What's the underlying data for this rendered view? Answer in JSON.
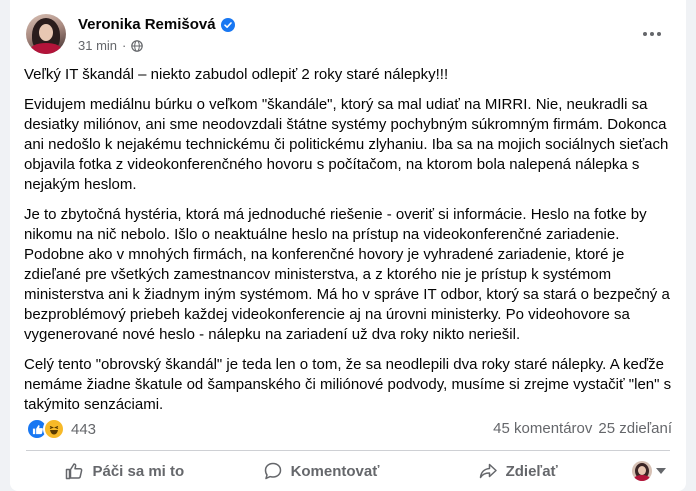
{
  "post": {
    "author": "Veronika Remišová",
    "time": "31 min",
    "separator": "·",
    "title": "Veľký IT škandál – niekto zabudol odlepiť 2 roky staré nálepky!!!",
    "paragraphs": [
      "Evidujem mediálnu búrku o veľkom \"škandále\", ktorý sa mal udiať na MIRRI. Nie, neukradli sa desiatky miliónov, ani sme neodovzdali štátne systémy pochybným súkromným firmám. Dokonca ani nedošlo k nejakému technickému či politickému zlyhaniu. Iba sa na mojich sociálnych sieťach objavila fotka z videokonferenčného hovoru s počítačom, na ktorom bola nalepená nálepka s nejakým heslom.",
      "Je to zbytočná hystéria, ktorá má jednoduché riešenie - overiť si informácie. Heslo na fotke by nikomu na nič nebolo. Išlo o neaktuálne heslo na prístup na videokonferenčné zariadenie. Podobne ako v mnohých firmách, na konferenčné hovory je vyhradené zariadenie, ktoré je zdieľané pre všetkých zamestnancov ministerstva, a z ktorého nie je prístup k systémom ministerstva ani k žiadnym iným systémom. Má ho v správe IT odbor, ktorý sa stará o bezpečný a bezproblémový priebeh každej videokonferencie aj na úrovni ministerky. Po videohovore sa vygenerované nové heslo - nálepku na zariadení už dva roky nikto neriešil.",
      "Celý tento \"obrovský škandál\" je teda len o tom, že sa neodlepili dva roky staré nálepky. A keďže nemáme žiadne škatule od šampanského či miliónové podvody, musíme si zrejme vystačiť \"len\" s takýmito senzáciami."
    ]
  },
  "engagement": {
    "reaction_count": "443",
    "comments": "45 komentárov",
    "shares": "25 zdieľaní"
  },
  "actions": {
    "like": "Páči sa mi to",
    "comment": "Komentovať",
    "share": "Zdieľať"
  },
  "colors": {
    "accent": "#1877f2",
    "muted_text": "#65676b",
    "background": "#f0f2f5"
  },
  "icons": [
    "verified-badge-icon",
    "globe-icon",
    "more-options-icon",
    "like-reaction-icon",
    "haha-reaction-icon",
    "thumbs-up-icon",
    "comment-icon",
    "share-icon",
    "chevron-down-icon"
  ]
}
